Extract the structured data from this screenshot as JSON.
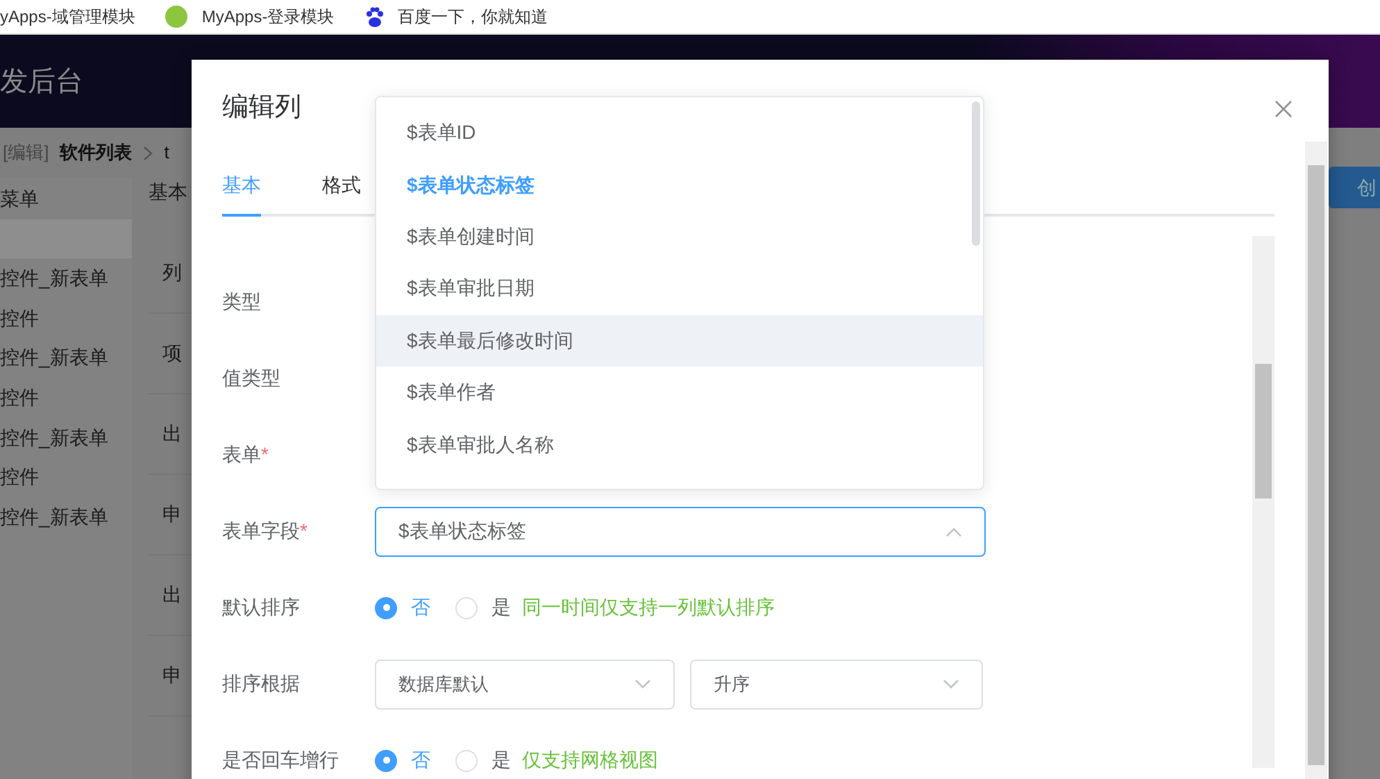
{
  "bookmarks": [
    {
      "label": "yApps-域管理模块",
      "kind": "plain"
    },
    {
      "label": "MyApps-登录模块",
      "kind": "w"
    },
    {
      "label": "百度一下，你就知道",
      "kind": "paw"
    }
  ],
  "header": {
    "title": "发后台"
  },
  "breadcrumb": {
    "edit": "[编辑]",
    "current": "软件列表",
    "next": "t"
  },
  "sidebar": {
    "title": "菜单",
    "items": [
      "控件_新表单",
      "控件",
      "控件_新表单",
      "控件",
      "控件_新表单",
      "控件",
      "控件_新表单"
    ]
  },
  "main": {
    "tab": "基本",
    "row_labels": [
      "列",
      "项",
      "出",
      "申",
      "出",
      "申"
    ],
    "create_button": "创"
  },
  "dialog": {
    "title": "编辑列",
    "tabs": [
      {
        "label": "基本",
        "selected": true
      },
      {
        "label": "格式",
        "selected": false
      }
    ],
    "fields": [
      {
        "label": "类型",
        "kind": "hidden"
      },
      {
        "label": "值类型",
        "kind": "hidden"
      },
      {
        "label": "表单",
        "required_mark": "*",
        "kind": "hidden"
      },
      {
        "label": "表单字段",
        "required_mark": "*",
        "kind": "select",
        "value": "$表单状态标签",
        "open": true
      },
      {
        "label": "默认排序",
        "kind": "radio",
        "options": [
          {
            "label": "否",
            "selected": true
          },
          {
            "label": "是",
            "selected": false
          }
        ],
        "hint": "同一时间仅支持一列默认排序"
      },
      {
        "label": "排序根据",
        "kind": "selects",
        "values": [
          "数据库默认",
          "升序"
        ]
      },
      {
        "label": "是否回车增行",
        "kind": "radio",
        "options": [
          {
            "label": "否",
            "selected": true
          },
          {
            "label": "是",
            "selected": false
          }
        ],
        "hint": "仅支持网格视图"
      }
    ],
    "dropdown": [
      {
        "label": "$表单ID",
        "selected": false,
        "hovered": false
      },
      {
        "label": "$表单状态标签",
        "selected": true,
        "hovered": false
      },
      {
        "label": "$表单创建时间",
        "selected": false,
        "hovered": false
      },
      {
        "label": "$表单审批日期",
        "selected": false,
        "hovered": false
      },
      {
        "label": "$表单最后修改时间",
        "selected": false,
        "hovered": true
      },
      {
        "label": "$表单作者",
        "selected": false,
        "hovered": false
      },
      {
        "label": "$表单审批人名称",
        "selected": false,
        "hovered": false
      }
    ]
  }
}
